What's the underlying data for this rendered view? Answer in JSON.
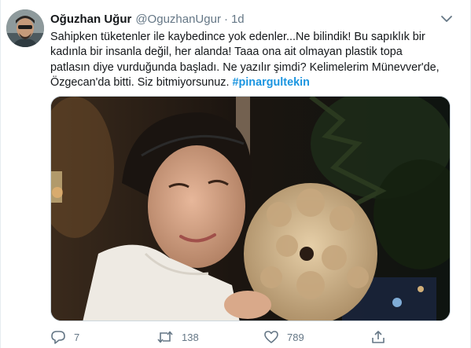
{
  "tweet": {
    "author": {
      "name": "Oğuzhan Uğur",
      "handle": "@OguzhanUgur",
      "separator": "·",
      "time": "1d"
    },
    "text_lines": [
      "Sahipken tüketenler ile kaybedince yok edenler...Ne bilindik! Bu sapıklık bir",
      "kadınla bir insanla değil, her alanda! Taaa ona ait olmayan plastik topa",
      "patlasın diye vurduğunda başladı. Ne yazılır şimdi? Kelimelerim Münevver'de,",
      "Özgecan'da bitti. Siz bitmiyorsunuz."
    ],
    "hashtag": "#pinargultekin",
    "counts": {
      "replies": "7",
      "retweets": "138",
      "likes": "789"
    }
  },
  "colors": {
    "text": "#14171a",
    "secondary": "#657786",
    "link": "#1b95e0",
    "border": "#e6ecf0"
  },
  "icons": {
    "menu": "chevron-down-icon",
    "reply": "reply-icon",
    "retweet": "retweet-icon",
    "like": "heart-icon",
    "share": "share-icon"
  }
}
